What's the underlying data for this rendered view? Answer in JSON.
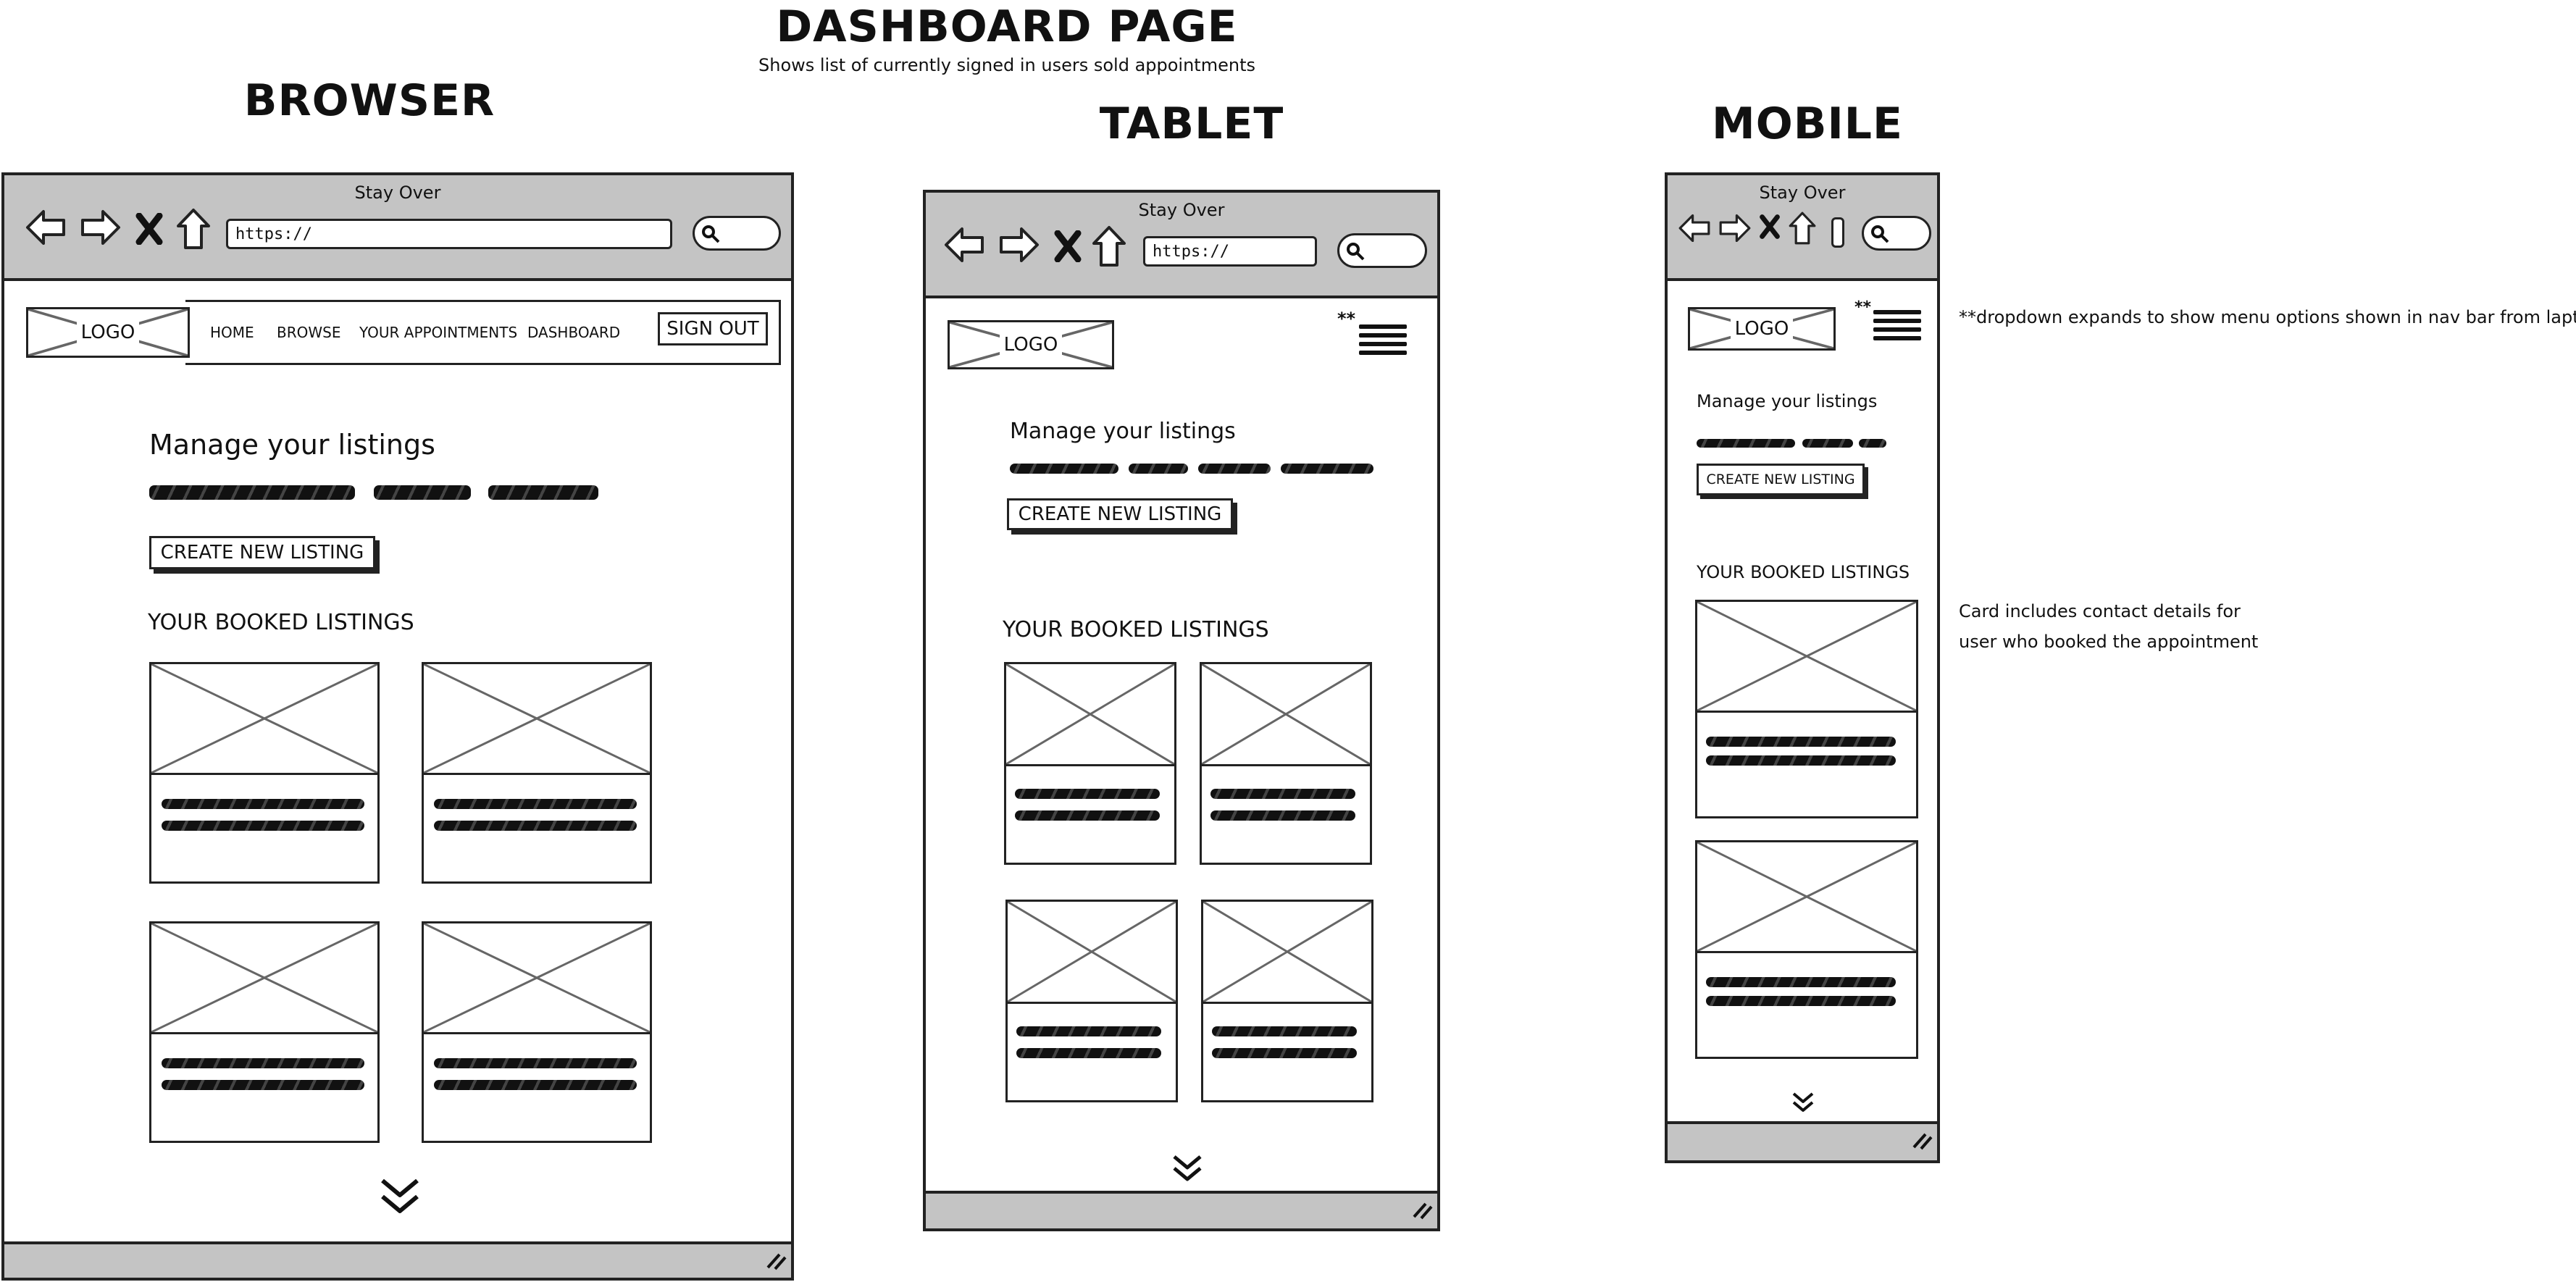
{
  "page_title": "DASHBOARD PAGE",
  "page_subtitle": "Shows list of currently signed in users sold appointments",
  "browser": {
    "label": "BROWSER",
    "window_title": "Stay Over",
    "url": "https://",
    "logo": "LOGO",
    "nav": [
      "HOME",
      "BROWSE",
      "YOUR APPOINTMENTS",
      "DASHBOARD"
    ],
    "sign_out": "SIGN OUT",
    "manage_heading": "Manage your listings",
    "create_button": "CREATE NEW LISTING",
    "booked_heading": "YOUR BOOKED LISTINGS"
  },
  "tablet": {
    "label": "TABLET",
    "window_title": "Stay Over",
    "url": "https://",
    "logo": "LOGO",
    "menu_marker": "**",
    "manage_heading": "Manage your listings",
    "create_button": "CREATE NEW LISTING",
    "booked_heading": "YOUR BOOKED LISTINGS"
  },
  "mobile": {
    "label": "MOBILE",
    "window_title": "Stay Over",
    "logo": "LOGO",
    "menu_marker": "**",
    "manage_heading": "Manage your listings",
    "create_button": "CREATE NEW LISTING",
    "booked_heading": "YOUR BOOKED LISTINGS"
  },
  "notes": {
    "dropdown": "**dropdown expands to show menu options shown in nav bar from laptop",
    "card_line1": "Card includes contact details for",
    "card_line2": "user who booked the appointment"
  },
  "icons": [
    "back-arrow-icon",
    "forward-arrow-icon",
    "close-icon",
    "home-icon",
    "search-icon",
    "hamburger-menu-icon",
    "scroll-down-chevron-icon",
    "resize-grip-icon",
    "image-placeholder-icon"
  ]
}
